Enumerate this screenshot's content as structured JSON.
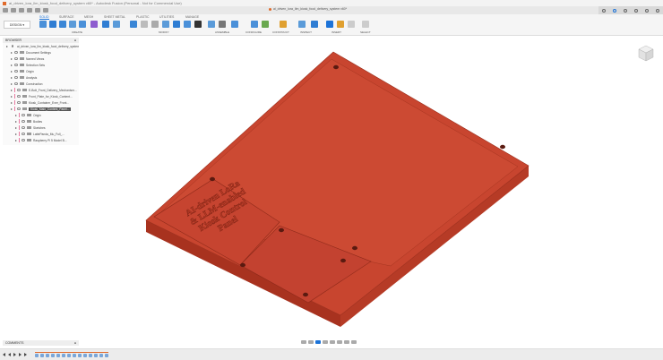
{
  "window": {
    "title": "ai_driven_lora_llm_kiosk_food_delivery_system v60* - Autodesk Fusion (Personal - Not for Commercial Use)"
  },
  "document_tab": "ai_driven_lora_llm_kiosk_food_delivery_system v60*",
  "workspace": "DESIGN",
  "tabs": [
    "SOLID",
    "SURFACE",
    "MESH",
    "SHEET METAL",
    "PLASTIC",
    "UTILITIES",
    "MANAGE"
  ],
  "active_tab": "SOLID",
  "groups": [
    "CREATE",
    "MODIFY",
    "ASSEMBLE",
    "CONFIGURE",
    "CONSTRUCT",
    "INSPECT",
    "INSERT",
    "SELECT"
  ],
  "browser": {
    "title": "BROWSER",
    "items": [
      {
        "label": "ai_driven_lora_llm_kiosk_food_delivery_system v60",
        "level": 0
      },
      {
        "label": "Document Settings",
        "level": 1
      },
      {
        "label": "Named Views",
        "level": 1
      },
      {
        "label": "Selection Sets",
        "level": 1
      },
      {
        "label": "Origin",
        "level": 1
      },
      {
        "label": "Analysis",
        "level": 1
      },
      {
        "label": "Construction",
        "level": 1
      },
      {
        "label": "E-Bolt_Front_Delivery_Mechanism...",
        "level": 1
      },
      {
        "label": "Front_Plate_for_Kiosk_Content...",
        "level": 1
      },
      {
        "label": "Kiosk_Container_Ever_Front...",
        "level": 1
      },
      {
        "label": "Kiosk_Main_Content_Panel...",
        "level": 1,
        "selected": true
      },
      {
        "label": "Origin",
        "level": 2
      },
      {
        "label": "Bodies",
        "level": 2
      },
      {
        "label": "Sketches",
        "level": 2
      },
      {
        "label": "LattePanda_Mu_Full_...",
        "level": 2
      },
      {
        "label": "Raspberry Pi 5 Model B...",
        "level": 2
      }
    ]
  },
  "model": {
    "engraving": [
      "AI-driven LoRa",
      "& LLM-enabled",
      "Kiosk Control",
      "Panel"
    ],
    "color": "#c8452f"
  },
  "comments": {
    "title": "COMMENTS"
  },
  "colors": {
    "accent": "#1c73d8",
    "model": "#c8452f"
  }
}
